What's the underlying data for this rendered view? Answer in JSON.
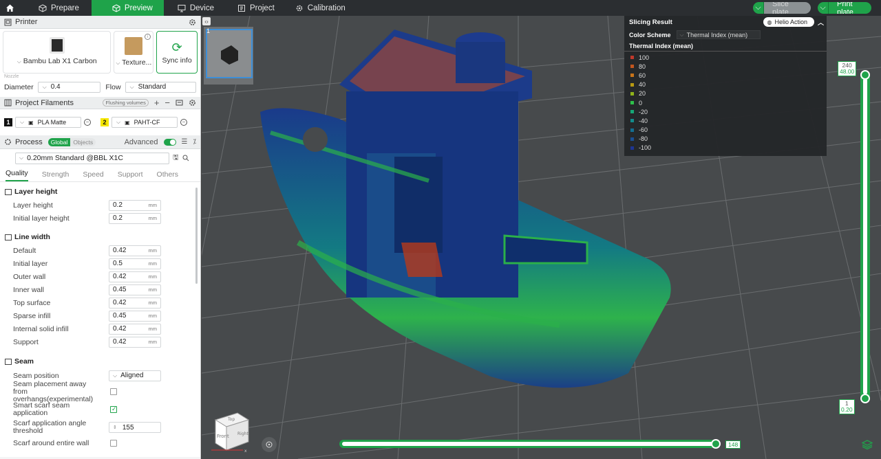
{
  "topbar": {
    "tabs": [
      {
        "label": "Prepare",
        "icon": "cube-icon"
      },
      {
        "label": "Preview",
        "icon": "preview-icon"
      },
      {
        "label": "Device",
        "icon": "monitor-icon"
      },
      {
        "label": "Project",
        "icon": "folder-icon"
      },
      {
        "label": "Calibration",
        "icon": "gear-icon"
      }
    ],
    "active_tab": "Preview",
    "slice_label": "Slice plate",
    "print_label": "Print plate"
  },
  "printer": {
    "section_title": "Printer",
    "printer_name": "Bambu Lab X1 Carbon",
    "plate_label": "Texture...",
    "sync_label": "Sync info",
    "nozzle_label": "Nozzle",
    "diameter_label": "Diameter",
    "diameter_value": "0.4",
    "flow_label": "Flow",
    "flow_value": "Standard"
  },
  "filaments": {
    "section_title": "Project Filaments",
    "flushing_label": "Flushing volumes",
    "items": [
      {
        "index": "1",
        "name": "PLA Matte",
        "color": "#111111"
      },
      {
        "index": "2",
        "name": "PAHT-CF",
        "color": "#f5e600"
      }
    ]
  },
  "process": {
    "section_title": "Process",
    "global_label": "Global",
    "objects_label": "Objects",
    "advanced_label": "Advanced",
    "advanced_on": true,
    "preset": "0.20mm Standard @BBL X1C",
    "tabs": [
      "Quality",
      "Strength",
      "Speed",
      "Support",
      "Others"
    ],
    "active_tab": "Quality"
  },
  "params": {
    "layer_height_group": "Layer height",
    "layer_height": {
      "label": "Layer height",
      "value": "0.2",
      "unit": "mm"
    },
    "initial_layer_height": {
      "label": "Initial layer height",
      "value": "0.2",
      "unit": "mm"
    },
    "line_width_group": "Line width",
    "line_width": [
      {
        "label": "Default",
        "value": "0.42",
        "unit": "mm"
      },
      {
        "label": "Initial layer",
        "value": "0.5",
        "unit": "mm"
      },
      {
        "label": "Outer wall",
        "value": "0.42",
        "unit": "mm"
      },
      {
        "label": "Inner wall",
        "value": "0.45",
        "unit": "mm"
      },
      {
        "label": "Top surface",
        "value": "0.42",
        "unit": "mm"
      },
      {
        "label": "Sparse infill",
        "value": "0.45",
        "unit": "mm"
      },
      {
        "label": "Internal solid infill",
        "value": "0.42",
        "unit": "mm"
      },
      {
        "label": "Support",
        "value": "0.42",
        "unit": "mm"
      }
    ],
    "seam_group": "Seam",
    "seam_position": {
      "label": "Seam position",
      "value": "Aligned"
    },
    "seam_away": {
      "label": "Seam placement away from overhangs(experimental)",
      "checked": false
    },
    "smart_scarf": {
      "label": "Smart scarf seam application",
      "checked": true
    },
    "scarf_angle": {
      "label": "Scarf application angle threshold",
      "value": "155"
    },
    "scarf_entire": {
      "label": "Scarf around entire wall",
      "checked": false
    }
  },
  "viewport": {
    "plate_number": "1",
    "slicing_result_title": "Slicing Result",
    "helio_label": "Helio Action",
    "color_scheme_label": "Color Scheme",
    "color_scheme_value": "Thermal Index (mean)",
    "legend_title": "Thermal Index (mean)",
    "legend": [
      {
        "value": "100",
        "color": "#c0392b"
      },
      {
        "value": "80",
        "color": "#c2561f"
      },
      {
        "value": "60",
        "color": "#c8741a"
      },
      {
        "value": "40",
        "color": "#b89a12"
      },
      {
        "value": "20",
        "color": "#8fb31a"
      },
      {
        "value": "0",
        "color": "#2ec14a"
      },
      {
        "value": "-20",
        "color": "#17a877"
      },
      {
        "value": "-40",
        "color": "#138c8c"
      },
      {
        "value": "-60",
        "color": "#136f91"
      },
      {
        "value": "-80",
        "color": "#1a4f92"
      },
      {
        "value": "-100",
        "color": "#1d3592"
      }
    ],
    "layer_top": "240",
    "layer_top_height": "48.00",
    "layer_bottom": "1",
    "layer_bottom_height": "0.20",
    "move_position": "148",
    "cube_front": "Front",
    "cube_top": "Top",
    "cube_right": "Right",
    "axis_x": "x"
  }
}
